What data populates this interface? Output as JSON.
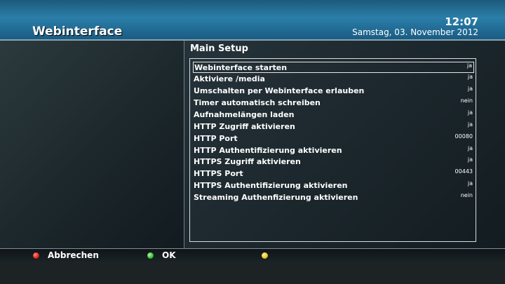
{
  "header": {
    "title": "Webinterface",
    "time": "12:07",
    "date": "Samstag, 03. November 2012"
  },
  "setup": {
    "title": "Main Setup",
    "items": [
      {
        "label": "Webinterface starten",
        "value": "ja"
      },
      {
        "label": "Aktiviere /media",
        "value": "ja"
      },
      {
        "label": "Umschalten per Webinterface erlauben",
        "value": "ja"
      },
      {
        "label": "Timer automatisch schreiben",
        "value": "nein"
      },
      {
        "label": "Aufnahmelängen laden",
        "value": "ja"
      },
      {
        "label": "HTTP Zugriff aktivieren",
        "value": "ja"
      },
      {
        "label": "HTTP Port",
        "value": "00080"
      },
      {
        "label": "HTTP Authentifizierung aktivieren",
        "value": "ja"
      },
      {
        "label": "HTTPS Zugriff aktivieren",
        "value": "ja"
      },
      {
        "label": "HTTPS Port",
        "value": "00443"
      },
      {
        "label": "HTTPS Authentifizierung aktivieren",
        "value": "ja"
      },
      {
        "label": "Streaming Authenfizierung aktivieren",
        "value": "nein"
      }
    ]
  },
  "footer": {
    "red_label": "Abbrechen",
    "green_label": "OK",
    "yellow_label": ""
  },
  "colors": {
    "red": "#e0201a",
    "green": "#2fbf2a",
    "yellow": "#e8c41a"
  }
}
